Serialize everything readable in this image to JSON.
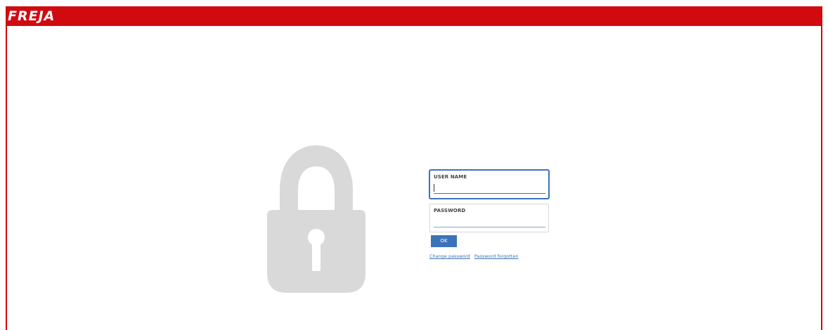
{
  "header": {
    "logo_text": "FREJA",
    "bar_color": "#d10a10"
  },
  "login": {
    "username_label": "USER NAME",
    "username_value": "",
    "password_label": "PASSWORD",
    "password_value": "",
    "ok_label": "OK",
    "change_password_label": "Change password",
    "password_forgotten_label": "Password forgotten",
    "accent_color": "#3b73b9"
  },
  "lock_icon": {
    "icon": "padlock-icon",
    "color": "#d9d9d9"
  }
}
